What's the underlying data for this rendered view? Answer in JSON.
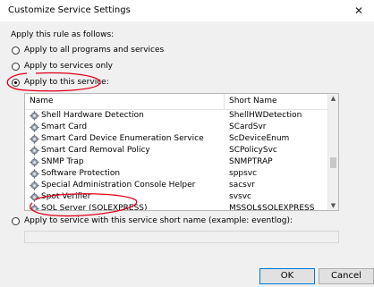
{
  "window": {
    "title": "Customize Service Settings"
  },
  "form": {
    "apply_label": "Apply this rule as follows:",
    "options": [
      {
        "label": "Apply to all programs and services",
        "checked": false
      },
      {
        "label": "Apply to services only",
        "checked": false
      },
      {
        "label": "Apply to this service:",
        "checked": true
      },
      {
        "label": "Apply to service with this service short name (example: eventlog):",
        "checked": false
      }
    ],
    "shortname_value": ""
  },
  "services": {
    "headers": {
      "name": "Name",
      "short_name": "Short Name"
    },
    "rows": [
      {
        "name": "Shell Hardware Detection",
        "short": "ShellHWDetection"
      },
      {
        "name": "Smart Card",
        "short": "SCardSvr"
      },
      {
        "name": "Smart Card Device Enumeration Service",
        "short": "ScDeviceEnum"
      },
      {
        "name": "Smart Card Removal Policy",
        "short": "SCPolicySvc"
      },
      {
        "name": "SNMP Trap",
        "short": "SNMPTRAP"
      },
      {
        "name": "Software Protection",
        "short": "sppsvc"
      },
      {
        "name": "Special Administration Console Helper",
        "short": "sacsvr"
      },
      {
        "name": "Spot Verifier",
        "short": "svsvc"
      },
      {
        "name": "SQL Server (SQLEXPRESS)",
        "short": "MSSQL$SQLEXPRESS"
      }
    ]
  },
  "buttons": {
    "ok": "OK",
    "cancel": "Cancel"
  },
  "colors": {
    "annotation": "#e0001b",
    "focus_border": "#0078d7"
  },
  "icons": {
    "close": "close-icon",
    "service": "gear-icon"
  }
}
